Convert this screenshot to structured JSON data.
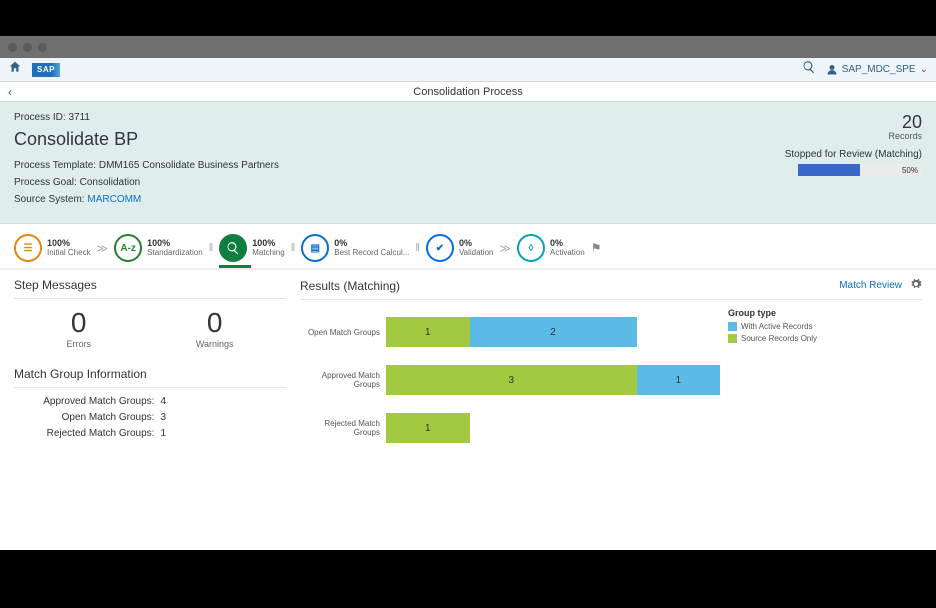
{
  "shell": {
    "logo": "SAP",
    "user": "SAP_MDC_SPE"
  },
  "subheader": {
    "title": "Consolidation Process"
  },
  "header": {
    "process_id_label": "Process ID:",
    "process_id": "3711",
    "title": "Consolidate BP",
    "template_label": "Process Template:",
    "template": "DMM165 Consolidate Business Partners",
    "goal_label": "Process Goal:",
    "goal": "Consolidation",
    "source_label": "Source System:",
    "source": "MARCOMM",
    "records_count": "20",
    "records_label": "Records",
    "status": "Stopped for Review (Matching)",
    "progress_pct": "50%"
  },
  "steps": [
    {
      "pct": "100%",
      "label": "Initial Check"
    },
    {
      "pct": "100%",
      "label": "Standardization"
    },
    {
      "pct": "100%",
      "label": "Matching"
    },
    {
      "pct": "0%",
      "label": "Best Record Calcul..."
    },
    {
      "pct": "0%",
      "label": "Validation"
    },
    {
      "pct": "0%",
      "label": "Activation"
    }
  ],
  "left": {
    "messages_title": "Step Messages",
    "errors": "0",
    "errors_label": "Errors",
    "warnings": "0",
    "warnings_label": "Warnings",
    "mgi_title": "Match Group Information",
    "approved_label": "Approved Match Groups:",
    "approved": "4",
    "open_label": "Open Match Groups:",
    "open": "3",
    "rejected_label": "Rejected Match Groups:",
    "rejected": "1"
  },
  "results": {
    "title": "Results (Matching)",
    "action": "Match Review",
    "legend_title": "Group type",
    "legend_active": "With Active Records",
    "legend_source": "Source Records Only",
    "rows": {
      "open": "Open Match Groups",
      "approved": "Approved Match Groups",
      "rejected": "Rejected Match Groups"
    }
  },
  "chart_data": {
    "type": "bar",
    "orientation": "horizontal",
    "categories": [
      "Open Match Groups",
      "Approved Match Groups",
      "Rejected Match Groups"
    ],
    "series": [
      {
        "name": "Source Records Only",
        "color": "#a3c940",
        "values": [
          1,
          3,
          1
        ]
      },
      {
        "name": "With Active Records",
        "color": "#5cbae6",
        "values": [
          2,
          1,
          0
        ]
      }
    ],
    "xlim": [
      0,
      4
    ]
  }
}
